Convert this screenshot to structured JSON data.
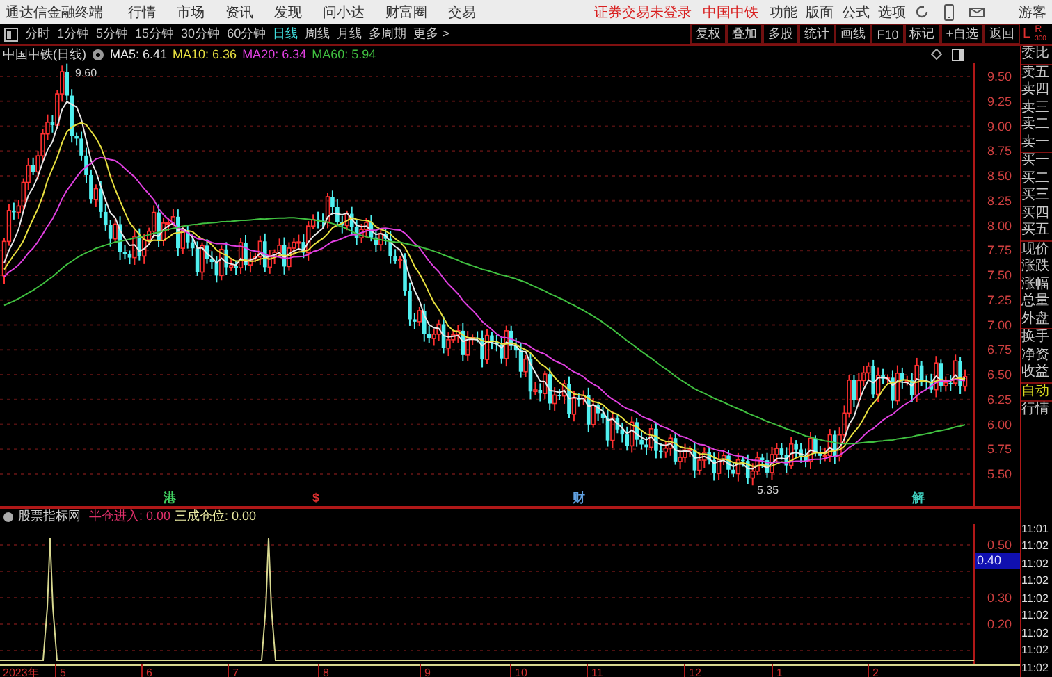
{
  "menu_bar": {
    "app_title": "通达信金融终端",
    "menus": [
      "行情",
      "市场",
      "资讯",
      "发现",
      "问小达",
      "财富圈",
      "交易"
    ],
    "login_status": "证券交易未登录",
    "stock": "中国中铁",
    "tools": [
      "功能",
      "版面",
      "公式",
      "选项"
    ],
    "user": "游客"
  },
  "toolbar": {
    "periods": [
      {
        "label": "分时",
        "selected": false
      },
      {
        "label": "1分钟",
        "selected": false
      },
      {
        "label": "5分钟",
        "selected": false
      },
      {
        "label": "15分钟",
        "selected": false
      },
      {
        "label": "30分钟",
        "selected": false
      },
      {
        "label": "60分钟",
        "selected": false
      },
      {
        "label": "日线",
        "selected": true
      },
      {
        "label": "周线",
        "selected": false
      },
      {
        "label": "月线",
        "selected": false
      },
      {
        "label": "多周期",
        "selected": false
      },
      {
        "label": "更多 >",
        "selected": false
      }
    ],
    "buttons": [
      "复权",
      "叠加",
      "多股",
      "统计",
      "画线",
      "F10",
      "标记",
      "+自选",
      "返回"
    ],
    "corner": {
      "left": "L",
      "right": "R",
      "sub": "300"
    }
  },
  "chart": {
    "title": "中国中铁(日线)",
    "indicators": [
      {
        "label": "MA5: 6.41",
        "color": "#e8e8e8"
      },
      {
        "label": "MA10: 6.36",
        "color": "#e8e040"
      },
      {
        "label": "MA20: 6.34",
        "color": "#e040e0"
      },
      {
        "label": "MA60: 5.94",
        "color": "#40c040"
      }
    ],
    "price_labels": [
      "9.50",
      "9.25",
      "9.00",
      "8.75",
      "8.50",
      "8.25",
      "8.00",
      "7.75",
      "7.50",
      "7.25",
      "7.00",
      "6.75",
      "6.50",
      "6.25",
      "6.00",
      "5.75",
      "5.50"
    ],
    "high_label": "9.60",
    "low_label": "5.35",
    "event_marks": [
      {
        "text": "港",
        "color": "#40d060"
      },
      {
        "text": "$",
        "color": "#e03030"
      },
      {
        "text": "财",
        "color": "#60a0e0"
      },
      {
        "text": "解",
        "color": "#40d0c0"
      }
    ]
  },
  "indicator_panel": {
    "name": "股票指标网",
    "values": [
      {
        "label": "半仓进入: 0.00",
        "color": "#e0306a"
      },
      {
        "label": "三成仓位: 0.00",
        "color": "#e8e8a0"
      }
    ],
    "axis_labels": [
      "0.50",
      "0.30",
      "0.20"
    ],
    "current_value": "0.40"
  },
  "x_axis": [
    "2023年",
    "5",
    "6",
    "7",
    "8",
    "9",
    "10",
    "11",
    "12",
    "1",
    "2"
  ],
  "quote_panel": {
    "groups": [
      [
        "委比"
      ],
      [
        "卖五",
        "卖四",
        "卖三",
        "卖二",
        "卖一"
      ],
      [
        "买一",
        "买二",
        "买三",
        "买四",
        "买五"
      ],
      [
        "现价",
        "涨跌",
        "涨幅",
        "总量",
        "外盘"
      ],
      [
        "换手",
        "净资",
        "收益"
      ]
    ],
    "mode": "自动",
    "tab": "行情",
    "times": [
      "11:01",
      "11:02",
      "11:02",
      "11:02",
      "11:02",
      "11:02",
      "11:02",
      "11:02",
      "11:02"
    ]
  }
}
